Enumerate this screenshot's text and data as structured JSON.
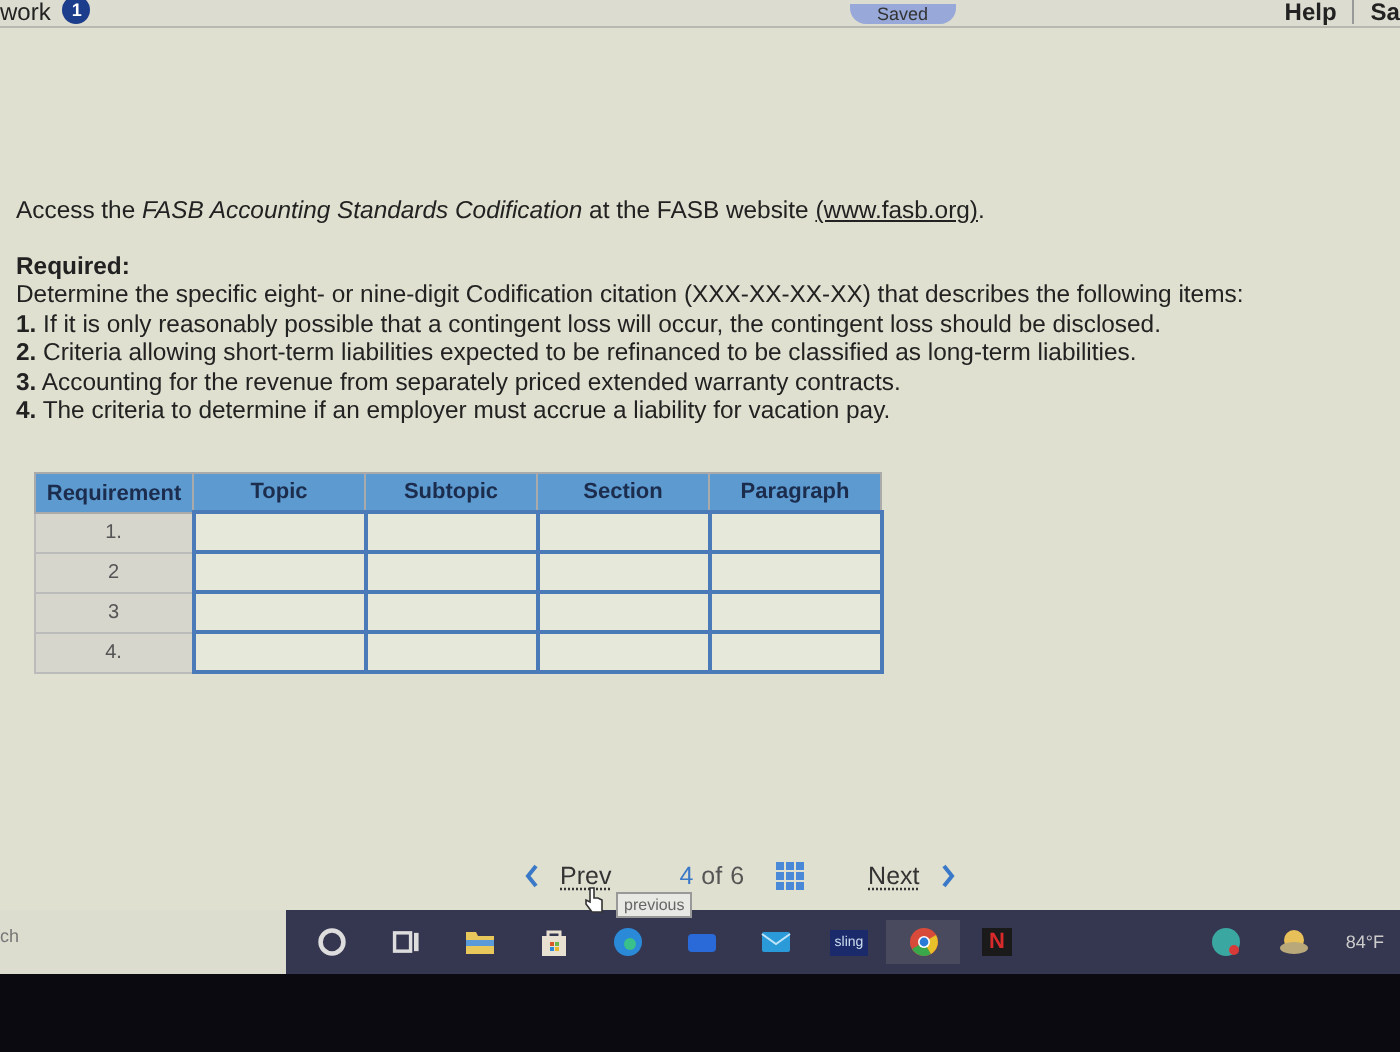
{
  "header": {
    "section_label": "work",
    "badge": "1",
    "status": "Saved",
    "help": "Help",
    "cut_label": "Sa"
  },
  "intro": {
    "before": "Access the *FASB Accounting Standards Codification* at the FASB website ",
    "link": "(www.fasb.org)",
    "after": "."
  },
  "required": {
    "heading": "Required:",
    "description": "Determine the specific eight- or nine-digit Codification citation (XXX-XX-XX-XX) that describes the following items:",
    "items": [
      {
        "number": "1.",
        "text": "If it is only reasonably possible that a contingent loss will occur, the contingent loss should be disclosed."
      },
      {
        "number": "2.",
        "text": "Criteria allowing short-term liabilities expected to be refinanced to be classified as long-term liabilities."
      },
      {
        "number": "3.",
        "text": "Accounting for the revenue from separately priced extended warranty contracts."
      },
      {
        "number": "4.",
        "text": "The criteria to determine if an employer must accrue a liability for vacation pay."
      }
    ]
  },
  "table": {
    "columns": [
      "Requirement",
      "Topic",
      "Subtopic",
      "Section",
      "Paragraph"
    ],
    "rows": [
      {
        "requirement": "1."
      },
      {
        "requirement": "2"
      },
      {
        "requirement": "3"
      },
      {
        "requirement": "4."
      }
    ]
  },
  "nav": {
    "prev": "Prev",
    "current": "4",
    "of": "of",
    "total": "6",
    "next": "Next",
    "tooltip": "previous"
  },
  "taskbar": {
    "search_stub": "ch",
    "apps": [
      {
        "kind": "circle",
        "selected": false
      },
      {
        "kind": "taskview",
        "selected": false
      },
      {
        "kind": "folder",
        "selected": false
      },
      {
        "kind": "store",
        "selected": false
      },
      {
        "kind": "edge",
        "selected": false
      },
      {
        "kind": "widget",
        "selected": false
      },
      {
        "kind": "mail",
        "selected": false
      },
      {
        "kind": "sling",
        "label": "sling",
        "selected": false
      },
      {
        "kind": "chrome",
        "selected": true
      },
      {
        "kind": "netflix",
        "label": "N",
        "selected": false
      }
    ],
    "temperature": "84°F"
  }
}
